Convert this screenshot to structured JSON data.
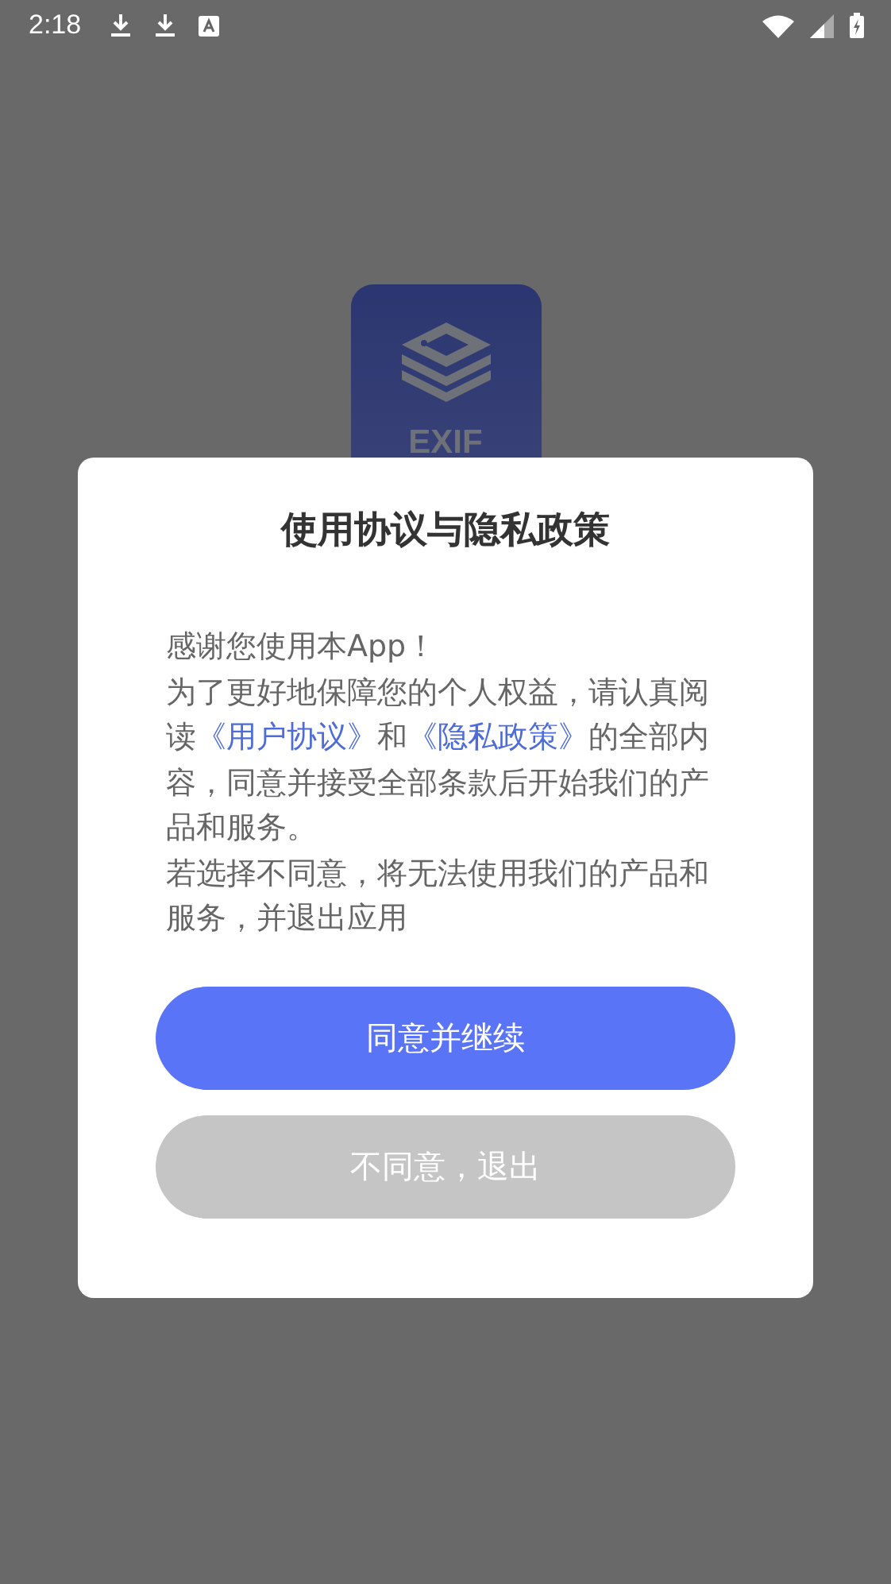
{
  "status_bar": {
    "time": "2:18"
  },
  "app_icon": {
    "label": "EXIF"
  },
  "dialog": {
    "title": "使用协议与隐私政策",
    "paragraphs": [
      [
        {
          "text": "感谢您使用本App！",
          "link": false
        }
      ],
      [
        {
          "text": "为了更好地保障您的个人权益，请认真阅读",
          "link": false
        },
        {
          "text": "《用户协议》",
          "link": true
        },
        {
          "text": "和",
          "link": false
        },
        {
          "text": "《隐私政策》",
          "link": true
        },
        {
          "text": "的全部内容，同意并接受全部条款后开始我们的产品和服务。",
          "link": false
        }
      ],
      [
        {
          "text": "若选择不同意，将无法使用我们的产品和服务，并退出应用",
          "link": false
        }
      ]
    ],
    "buttons": [
      {
        "label": "同意并继续",
        "kind": "primary"
      },
      {
        "label": "不同意，退出",
        "kind": "secondary"
      }
    ]
  }
}
